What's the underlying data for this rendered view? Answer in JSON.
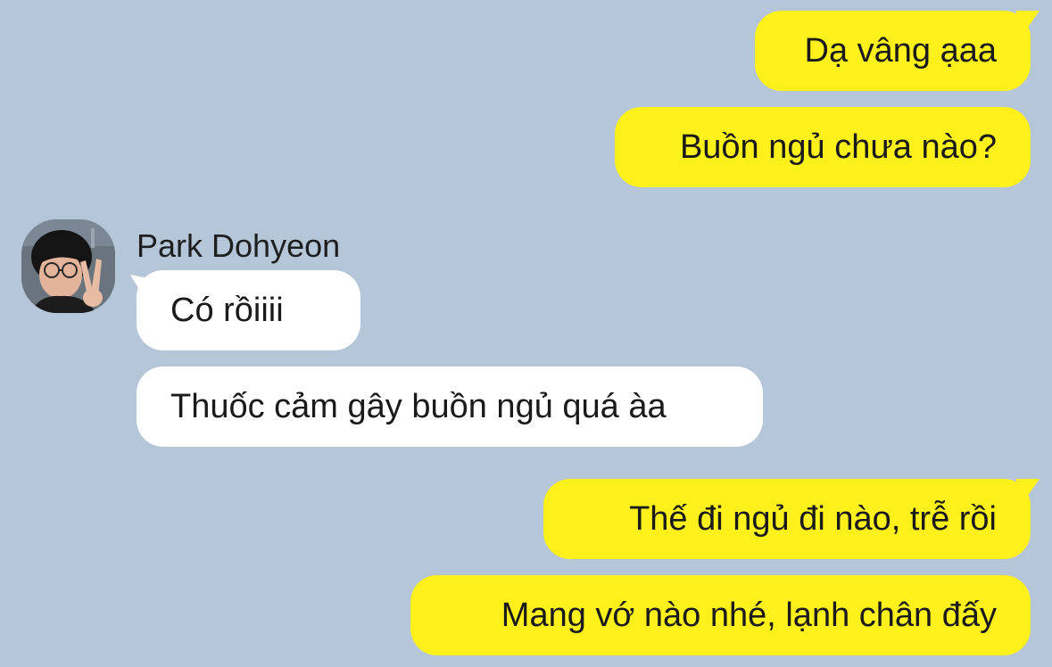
{
  "conversation": {
    "contact": {
      "name": "Park Dohyeon",
      "avatar_icon": "profile-photo-peace-sign"
    },
    "colors": {
      "background": "#b5c6d9",
      "outgoing_bubble": "#fef01b",
      "incoming_bubble": "#ffffff"
    },
    "messages": [
      {
        "sender": "me",
        "text": "Dạ vâng ạaa"
      },
      {
        "sender": "me",
        "text": "Buồn ngủ chưa nào?"
      },
      {
        "sender": "Park Dohyeon",
        "text": "Có rồiiii"
      },
      {
        "sender": "Park Dohyeon",
        "text": "Thuốc cảm gây buồn ngủ quá àa"
      },
      {
        "sender": "me",
        "text": "Thế đi ngủ đi nào, trễ rồi"
      },
      {
        "sender": "me",
        "text": "Mang vớ nào nhé, lạnh chân đấy"
      }
    ]
  }
}
